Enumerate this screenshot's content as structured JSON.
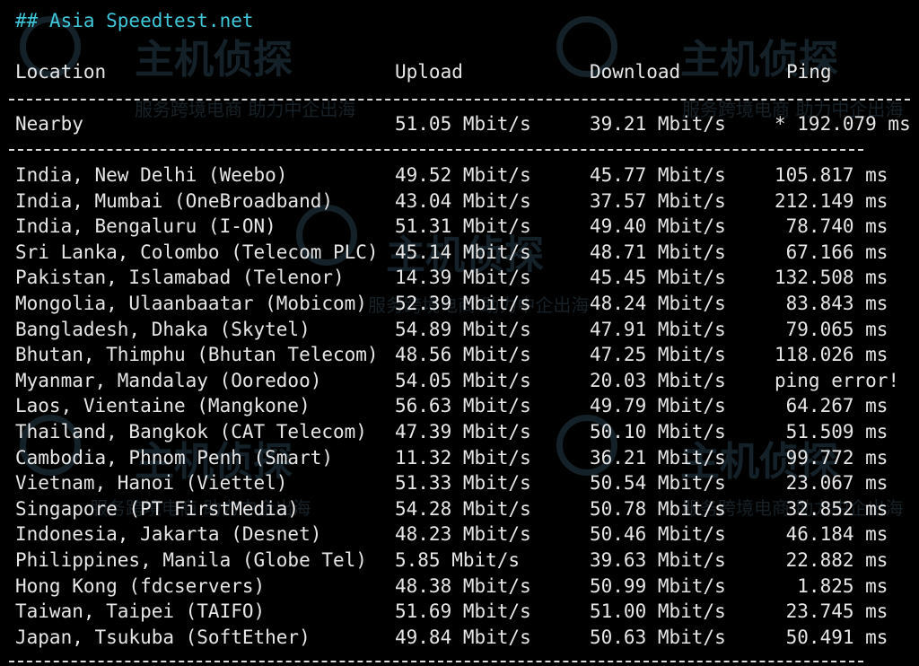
{
  "terminal": {
    "title": "## Asia Speedtest.net",
    "headers": {
      "location": "Location",
      "upload": "Upload",
      "download": "Download",
      "ping": "Ping"
    },
    "nearby": {
      "location": "Nearby",
      "upload": "51.05 Mbit/s",
      "download": "39.21 Mbit/s",
      "ping": "* 192.079 ms"
    },
    "rows": [
      {
        "location": "India, New Delhi (Weebo)",
        "upload": "49.52 Mbit/s",
        "download": "45.77 Mbit/s",
        "ping": "105.817 ms"
      },
      {
        "location": "India, Mumbai (OneBroadband)",
        "upload": "43.04 Mbit/s",
        "download": "37.57 Mbit/s",
        "ping": "212.149 ms"
      },
      {
        "location": "India, Bengaluru (I-ON)",
        "upload": "51.31 Mbit/s",
        "download": "49.40 Mbit/s",
        "ping": " 78.740 ms"
      },
      {
        "location": "Sri Lanka, Colombo (Telecom PLC)",
        "upload": "45.14 Mbit/s",
        "download": "48.71 Mbit/s",
        "ping": " 67.166 ms"
      },
      {
        "location": "Pakistan, Islamabad (Telenor)",
        "upload": "14.39 Mbit/s",
        "download": "45.45 Mbit/s",
        "ping": "132.508 ms"
      },
      {
        "location": "Mongolia, Ulaanbaatar (Mobicom)",
        "upload": "52.39 Mbit/s",
        "download": "48.24 Mbit/s",
        "ping": " 83.843 ms"
      },
      {
        "location": "Bangladesh, Dhaka (Skytel)",
        "upload": "54.89 Mbit/s",
        "download": "47.91 Mbit/s",
        "ping": " 79.065 ms"
      },
      {
        "location": "Bhutan, Thimphu (Bhutan Telecom)",
        "upload": "48.56 Mbit/s",
        "download": "47.25 Mbit/s",
        "ping": "118.026 ms"
      },
      {
        "location": "Myanmar, Mandalay (Ooredoo)",
        "upload": "54.05 Mbit/s",
        "download": "20.03 Mbit/s",
        "ping": "ping error!"
      },
      {
        "location": "Laos, Vientaine (Mangkone)",
        "upload": "56.63 Mbit/s",
        "download": "49.79 Mbit/s",
        "ping": " 64.267 ms"
      },
      {
        "location": "Thailand, Bangkok (CAT Telecom)",
        "upload": "47.39 Mbit/s",
        "download": "50.10 Mbit/s",
        "ping": " 51.509 ms"
      },
      {
        "location": "Cambodia, Phnom Penh (Smart)",
        "upload": "11.32 Mbit/s",
        "download": "36.21 Mbit/s",
        "ping": " 99.772 ms"
      },
      {
        "location": "Vietnam, Hanoi (Viettel)",
        "upload": "51.33 Mbit/s",
        "download": "50.54 Mbit/s",
        "ping": " 23.067 ms"
      },
      {
        "location": "Singapore (PT FirstMedia)",
        "upload": "54.28 Mbit/s",
        "download": "50.78 Mbit/s",
        "ping": " 32.852 ms"
      },
      {
        "location": "Indonesia, Jakarta (Desnet)",
        "upload": "48.23 Mbit/s",
        "download": "50.46 Mbit/s",
        "ping": " 46.184 ms"
      },
      {
        "location": "Philippines, Manila (Globe Tel)",
        "upload": "5.85 Mbit/s",
        "download": "39.63 Mbit/s",
        "ping": " 22.882 ms"
      },
      {
        "location": "Hong Kong (fdcservers)",
        "upload": "48.38 Mbit/s",
        "download": "50.99 Mbit/s",
        "ping": "  1.825 ms"
      },
      {
        "location": "Taiwan, Taipei (TAIFO)",
        "upload": "51.69 Mbit/s",
        "download": "51.00 Mbit/s",
        "ping": " 23.745 ms"
      },
      {
        "location": "Japan, Tsukuba (SoftEther)",
        "upload": "49.84 Mbit/s",
        "download": "50.63 Mbit/s",
        "ping": " 50.491 ms"
      }
    ]
  },
  "watermark": {
    "brand": "主机侦探",
    "slogan": "服务跨境电商 助力中企出海"
  },
  "colors": {
    "background": "#000000",
    "text": "#e6e6e6",
    "title": "#3fc6d8"
  }
}
